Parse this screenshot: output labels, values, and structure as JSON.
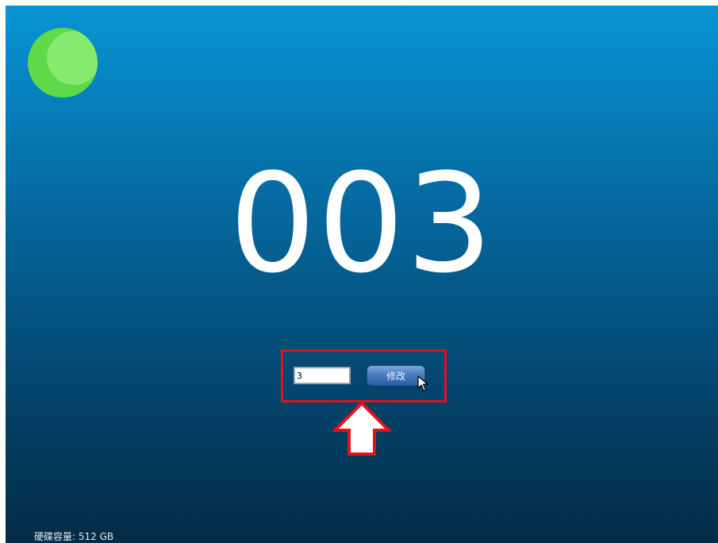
{
  "counter": {
    "value": "003"
  },
  "status_light": {
    "icon": "green-circle-icon",
    "color": "#5fd84a"
  },
  "form": {
    "input_value": "3",
    "submit_label": "修改"
  },
  "annotation": {
    "highlight_color": "#e0121a",
    "arrow_icon": "up-arrow-icon"
  },
  "footer": {
    "disk_capacity": "硬碟容量: 512 GB"
  }
}
